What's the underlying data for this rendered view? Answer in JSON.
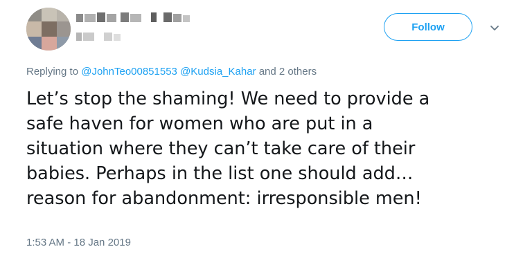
{
  "author": {
    "display_name_blurred": true,
    "handle_blurred": true
  },
  "follow_button": {
    "label": "Follow"
  },
  "reply": {
    "prefix": "Replying to",
    "mentions": [
      "@JohnTeo00851553",
      "@Kudsia_Kahar"
    ],
    "suffix": "and 2 others"
  },
  "tweet": {
    "lines": [
      "Let’s stop the shaming! We need to provide a",
      "safe haven for women who are put in a",
      "situation where they can’t take care of their",
      "babies. Perhaps in the list one should add…",
      "reason for abandonment: irresponsible men!"
    ]
  },
  "timestamp": "1:53 AM - 18 Jan 2019",
  "colors": {
    "accent": "#1da1f2",
    "secondary_text": "#657786",
    "primary_text": "#14171a"
  },
  "icons": {
    "menu": "chevron-down-icon"
  }
}
